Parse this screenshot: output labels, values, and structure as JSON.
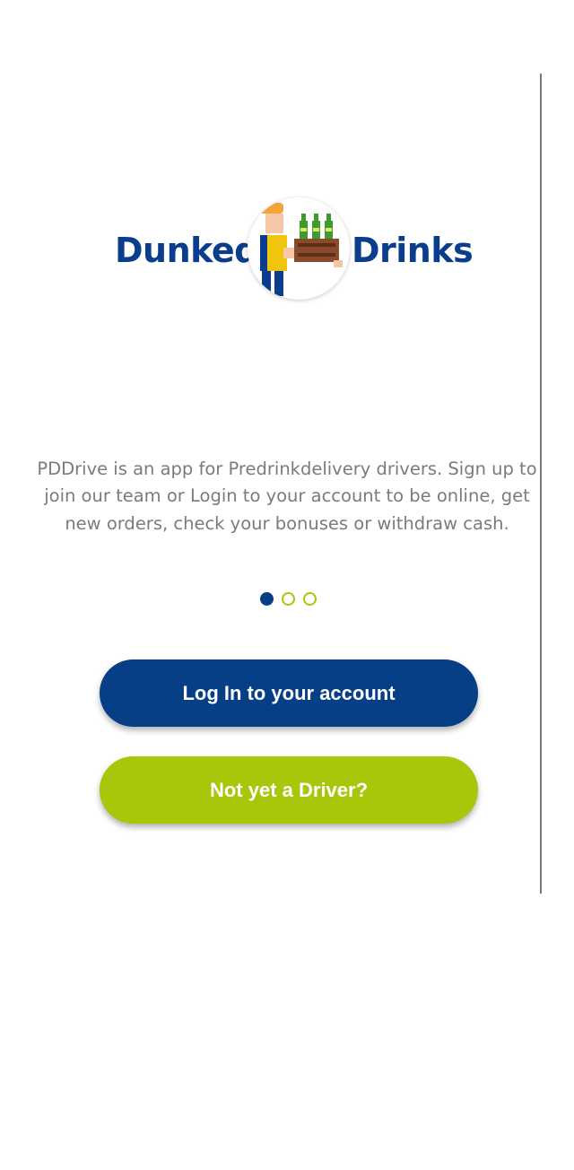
{
  "brand": {
    "name_left": "Dunked",
    "name_right": "Drinks",
    "logo_icon": "delivery-driver-carrying-bottle-crate"
  },
  "intro": {
    "text": "PDDrive is an app for Predrinkdelivery drivers. Sign up to join our team or Login to your account to be online, get new orders, check your bonuses or withdraw cash."
  },
  "pager": {
    "total": 3,
    "active_index": 0
  },
  "buttons": {
    "login_label": "Log In to your account",
    "signup_label": "Not yet a Driver?"
  },
  "colors": {
    "primary_blue": "#073f86",
    "accent_green": "#a6c70a",
    "text_gray": "#7b7b7b",
    "brand_text": "#0a3d8c",
    "hat_orange": "#f2a33a",
    "vest_yellow": "#f1c40f",
    "crate_brown": "#8a4b2a",
    "bottle_green": "#3f9b2f"
  }
}
